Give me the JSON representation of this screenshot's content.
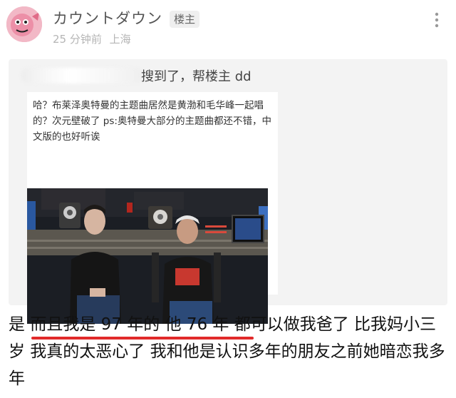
{
  "post": {
    "username": "カウントダウン",
    "op_badge": "楼主",
    "time_ago": "25 分钟前",
    "location": "上海",
    "more_icon": "more-vertical-icon"
  },
  "quote": {
    "reply_text": "搜到了，帮楼主 dd",
    "shared_text": "哈？布莱泽奥特曼的主题曲居然是黄渤和毛华峰一起唱的？次元壁破了 ps:奥特曼大部分的主题曲都还不错，中文版的也好听诶",
    "video_icon": "video-thumbnail"
  },
  "body": {
    "prefix": "是 ",
    "highlight": "而且我是 97 年的 他 76 年",
    "rest": " 都可以做我爸了 比我妈小三岁 我真的太恶心了 我和他是认识多年的朋友之前她暗恋我多年"
  }
}
